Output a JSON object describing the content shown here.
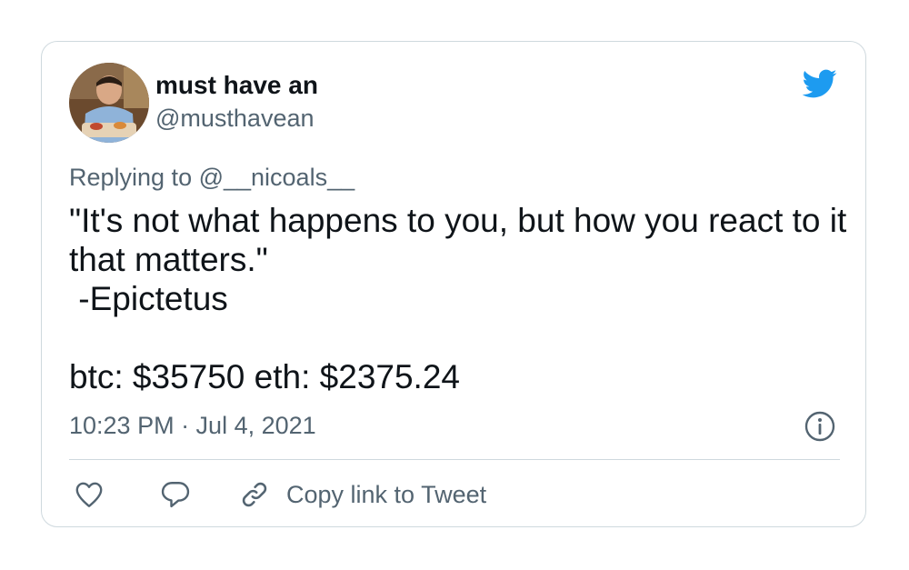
{
  "user": {
    "display_name": "must have an",
    "handle": "@musthavean"
  },
  "tweet": {
    "replying_to": "Replying to @__nicoals__",
    "text": "\"It's not what happens to you, but how you react to it that matters.\"\n -Epictetus\n\nbtc: $35750 eth: $2375.24",
    "timestamp": "10:23 PM · Jul 4, 2021"
  },
  "actions": {
    "copy_link_label": "Copy link to Tweet"
  },
  "icons": {
    "brand": "twitter-bird-icon",
    "info": "info-icon",
    "like": "heart-icon",
    "reply": "speech-bubble-icon",
    "copy_link": "link-icon"
  },
  "colors": {
    "brand": "#1d9bf0",
    "text_primary": "#0f1419",
    "text_secondary": "#536471",
    "border": "#cfd9de"
  }
}
